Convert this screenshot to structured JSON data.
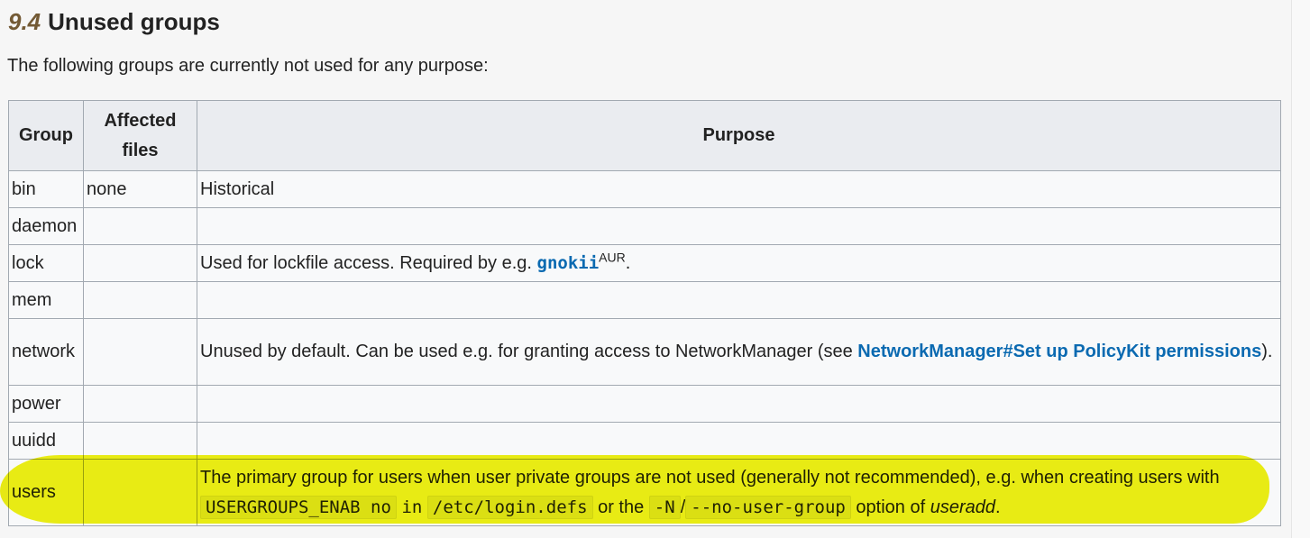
{
  "heading": {
    "number": "9.4",
    "title": "Unused groups"
  },
  "intro": "The following groups are currently not used for any purpose:",
  "table": {
    "headers": {
      "group": "Group",
      "files_line1": "Affected",
      "files_line2": "files",
      "purpose": "Purpose"
    },
    "rows": [
      {
        "group": "bin",
        "files": "none",
        "purpose": "Historical"
      },
      {
        "group": "daemon",
        "files": "",
        "purpose": ""
      },
      {
        "group": "lock",
        "files": "",
        "purpose_before": "Used for lockfile access. Required by e.g. ",
        "link": "gnokii",
        "sup": "AUR",
        "purpose_after": "."
      },
      {
        "group": "mem",
        "files": "",
        "purpose": ""
      },
      {
        "group": "network",
        "files": "",
        "purpose_before": "Unused by default. Can be used e.g. for granting access to NetworkManager (see ",
        "link": "NetworkManager#Set up PolicyKit permissions",
        "purpose_after": ")."
      },
      {
        "group": "power",
        "files": "",
        "purpose": ""
      },
      {
        "group": "uuidd",
        "files": "",
        "purpose": ""
      },
      {
        "group": "users",
        "files": "",
        "purpose_line": "The primary group for users when user private groups are not used (generally not recommended), e.g. when creating users with",
        "code1": "USERGROUPS_ENAB no",
        "in_word": "in",
        "code2": "/etc/login.defs",
        "or_the": "or the",
        "code3": "-N",
        "slash": "/",
        "code4": "--no-user-group",
        "option_of": "option of",
        "cmd": "useradd",
        "end": "."
      }
    ]
  },
  "colors": {
    "link": "#0b6ab1",
    "header_bg": "#eaecf0",
    "border": "#a2a9b1",
    "highlight": "#eef000",
    "section_number": "#735a35"
  }
}
